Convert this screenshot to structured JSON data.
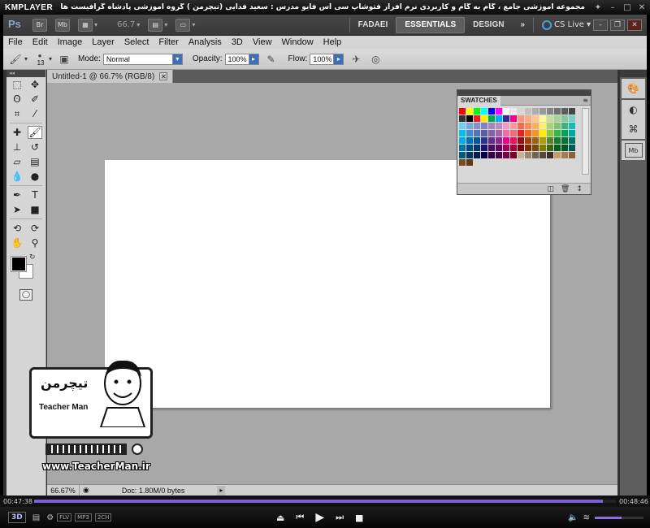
{
  "player": {
    "name": "KMPLAYER",
    "caption": "مجموعه آموزشی جامع ، گام به گام و کاربردی نرم افزار فتوشاپ سی اس فایو  مدرس : سعید فدایی (تیچرمن ) گروه آموزشی پادشاه گرافیست ها",
    "time_current": "00:47:38",
    "time_total": "00:48:46",
    "progress": 0.977,
    "volume": 0.55,
    "label_3d": "3D",
    "tags": [
      "FLV",
      "MP3",
      "2CH"
    ]
  },
  "app": {
    "logo": "Ps",
    "chips": [
      "Br",
      "Mb"
    ],
    "zoom_readout": "66.7",
    "workspaces": [
      "FADAEI",
      "ESSENTIALS",
      "DESIGN"
    ],
    "active_workspace": "ESSENTIALS",
    "cs_live": "CS Live"
  },
  "menu": [
    "File",
    "Edit",
    "Image",
    "Layer",
    "Select",
    "Filter",
    "Analysis",
    "3D",
    "View",
    "Window",
    "Help"
  ],
  "options": {
    "brush_size": "13",
    "mode_label": "Mode:",
    "mode_value": "Normal",
    "opacity_label": "Opacity:",
    "opacity_value": "100%",
    "flow_label": "Flow:",
    "flow_value": "100%"
  },
  "document": {
    "tab_title": "Untitled-1 @ 66.7% (RGB/8)",
    "status_zoom": "66.67%",
    "status_doc": "Doc: 1.80M/0 bytes"
  },
  "swatches": {
    "title": "SWATCHES",
    "colors": [
      "#ff0000",
      "#ffff00",
      "#00ff00",
      "#00ffff",
      "#0000ff",
      "#ff00ff",
      "#ffffff",
      "#ebebeb",
      "#d6d6d6",
      "#c2c2c2",
      "#adadad",
      "#999999",
      "#858585",
      "#707070",
      "#5c5c5c",
      "#474747",
      "#333333",
      "#000000",
      "#ee1d24",
      "#fff100",
      "#00a650",
      "#00aeef",
      "#2e3192",
      "#ec008c",
      "#f7977a",
      "#fbad82",
      "#fdc68c",
      "#fff799",
      "#c6df9c",
      "#a4d49d",
      "#81ca9d",
      "#7bcdc9",
      "#6ccff7",
      "#7ca6d8",
      "#8293ca",
      "#8881be",
      "#a286bd",
      "#bc8cbf",
      "#f49bc1",
      "#f5999d",
      "#f16c4d",
      "#f68e54",
      "#fbaf5a",
      "#fff467",
      "#acd372",
      "#7dc473",
      "#39b778",
      "#16bcb4",
      "#00bff3",
      "#438ccb",
      "#5573b7",
      "#5e5ca7",
      "#855fa8",
      "#a763a9",
      "#ef6ea8",
      "#f16d7e",
      "#ee1d24",
      "#f16522",
      "#f7941d",
      "#fff100",
      "#8fc63d",
      "#37b44a",
      "#00a650",
      "#00a99e",
      "#00aeef",
      "#0072bc",
      "#0054a5",
      "#2f3192",
      "#652c91",
      "#91278f",
      "#ed008c",
      "#ee105a",
      "#9d0a0f",
      "#a1410d",
      "#a36209",
      "#aba000",
      "#588528",
      "#197b30",
      "#007236",
      "#00736a",
      "#0076a4",
      "#004a80",
      "#003370",
      "#1d1363",
      "#450e61",
      "#62055f",
      "#9e005c",
      "#9d0039",
      "#790000",
      "#7b3000",
      "#7c4900",
      "#827a00",
      "#3e6617",
      "#045f20",
      "#005824",
      "#005951",
      "#005b7e",
      "#003562",
      "#002056",
      "#0c004b",
      "#30004a",
      "#4b0048",
      "#7a0045",
      "#7a0026",
      "#c7b299",
      "#998675",
      "#736357",
      "#534741",
      "#37302a",
      "#c69c6d",
      "#a67c52",
      "#8c6239",
      "#754c24",
      "#603913"
    ]
  },
  "watermark": {
    "farsi": "تیچرمن",
    "name": "Teacher Man",
    "url": "www.TeacherMan.ir"
  }
}
